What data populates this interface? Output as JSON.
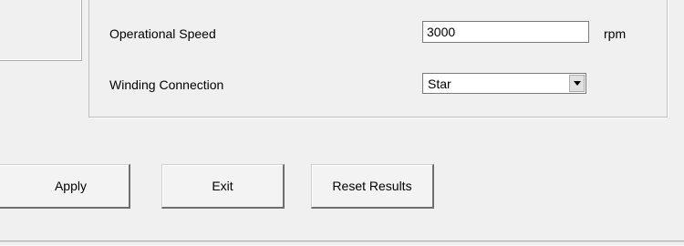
{
  "settings": {
    "operational_speed": {
      "label": "Operational Speed",
      "value": "3000",
      "unit": "rpm"
    },
    "winding_connection": {
      "label": "Winding Connection",
      "selected": "Star"
    }
  },
  "buttons": {
    "apply": "Apply",
    "exit": "Exit",
    "reset_results": "Reset Results"
  },
  "icons": {
    "combo_arrow": "chevron-down-icon"
  }
}
